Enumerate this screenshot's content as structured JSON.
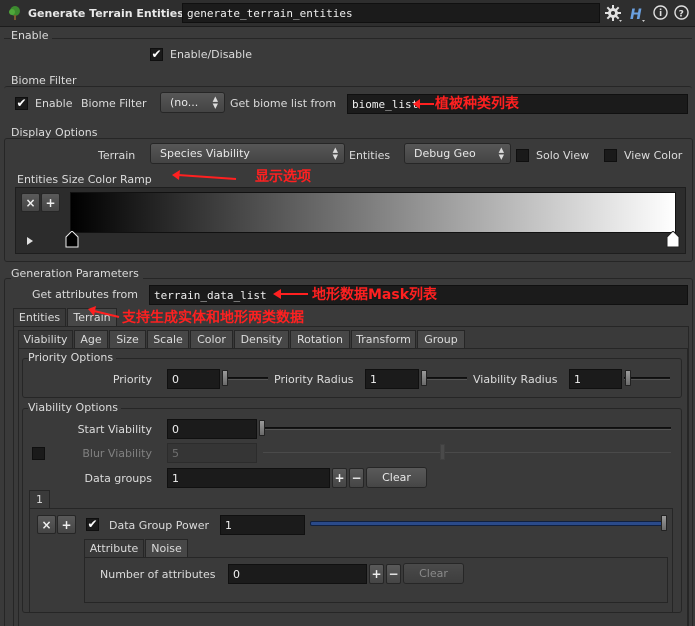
{
  "header": {
    "node_type": "Generate Terrain Entities",
    "node_name": "generate_terrain_entities"
  },
  "enable": {
    "section_title": "Enable",
    "checkbox_label": "Enable/Disable"
  },
  "biome_filter": {
    "section_title": "Biome Filter",
    "enable_label": "Enable",
    "filter_label": "Biome Filter",
    "filter_value": "(no...",
    "list_label": "Get biome list from",
    "list_value": "biome_list"
  },
  "display_options": {
    "section_title": "Display Options",
    "terrain_label": "Terrain",
    "terrain_value": "Species Viability",
    "entities_label": "Entities",
    "entities_value": "Debug Geo",
    "solo_view_label": "Solo View",
    "view_color_label": "View Color",
    "ramp_label": "Entities Size Color Ramp",
    "ramp_remove": "×",
    "ramp_add": "+"
  },
  "generation": {
    "section_title": "Generation Parameters",
    "attr_label": "Get attributes from",
    "attr_value": "terrain_data_list",
    "top_tabs": [
      "Entities",
      "Terrain"
    ],
    "sub_tabs": [
      "Viability",
      "Age",
      "Size",
      "Scale",
      "Color",
      "Density",
      "Rotation",
      "Transform",
      "Group"
    ],
    "priority": {
      "section_title": "Priority Options",
      "priority_label": "Priority",
      "priority_value": "0",
      "radius_label": "Priority Radius",
      "radius_value": "1",
      "viability_radius_label": "Viability Radius",
      "viability_radius_value": "1"
    },
    "viability": {
      "section_title": "Viability Options",
      "start_label": "Start Viability",
      "start_value": "0",
      "blur_label": "Blur Viability",
      "blur_value": "5",
      "groups_label": "Data groups",
      "groups_value": "1",
      "plus": "+",
      "minus": "−",
      "clear": "Clear",
      "group_tab": "1",
      "group_remove": "×",
      "group_add": "+",
      "power_label": "Data Group Power",
      "power_value": "1",
      "inner_tabs": [
        "Attribute",
        "Noise"
      ],
      "num_attr_label": "Number of attributes",
      "num_attr_value": "0"
    }
  },
  "annotations": {
    "biome": "植被种类列表",
    "display": "显示选项",
    "mask": "地形数据Mask列表",
    "support": "支持生成实体和地形两类数据"
  },
  "colors": {
    "annotation": "#ff2020",
    "panel": "#3a3a3a",
    "field": "#1b1b1b",
    "power_bar": "#2a4a8a"
  },
  "icons": [
    "terrain-node-icon",
    "gear-icon",
    "houdini-help-icon",
    "info-icon",
    "help-icon"
  ]
}
